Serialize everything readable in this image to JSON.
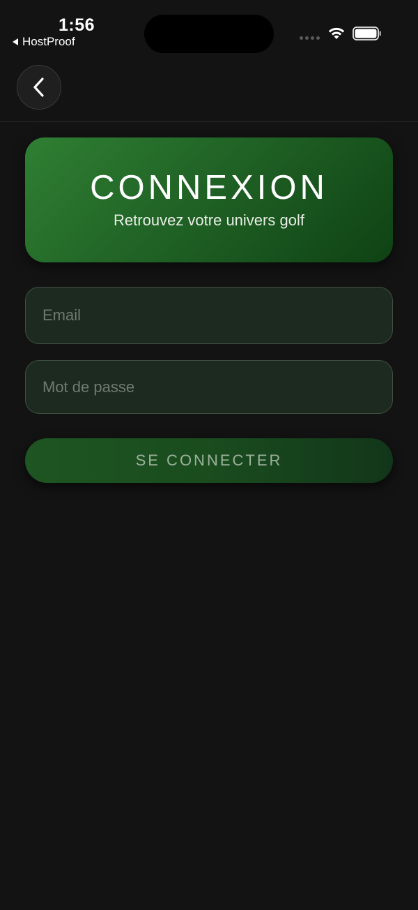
{
  "status_bar": {
    "time": "1:56",
    "back_app_label": "HostProof"
  },
  "nav": {
    "back_icon": "chevron-left-icon"
  },
  "hero": {
    "title": "CONNEXION",
    "subtitle": "Retrouvez votre univers golf"
  },
  "form": {
    "email_placeholder": "Email",
    "email_value": "",
    "password_placeholder": "Mot de passe",
    "password_value": "",
    "submit_label": "SE CONNECTER"
  },
  "colors": {
    "background": "#131313",
    "accent_green": "#2f7f33",
    "field_bg": "#1d2a20"
  }
}
